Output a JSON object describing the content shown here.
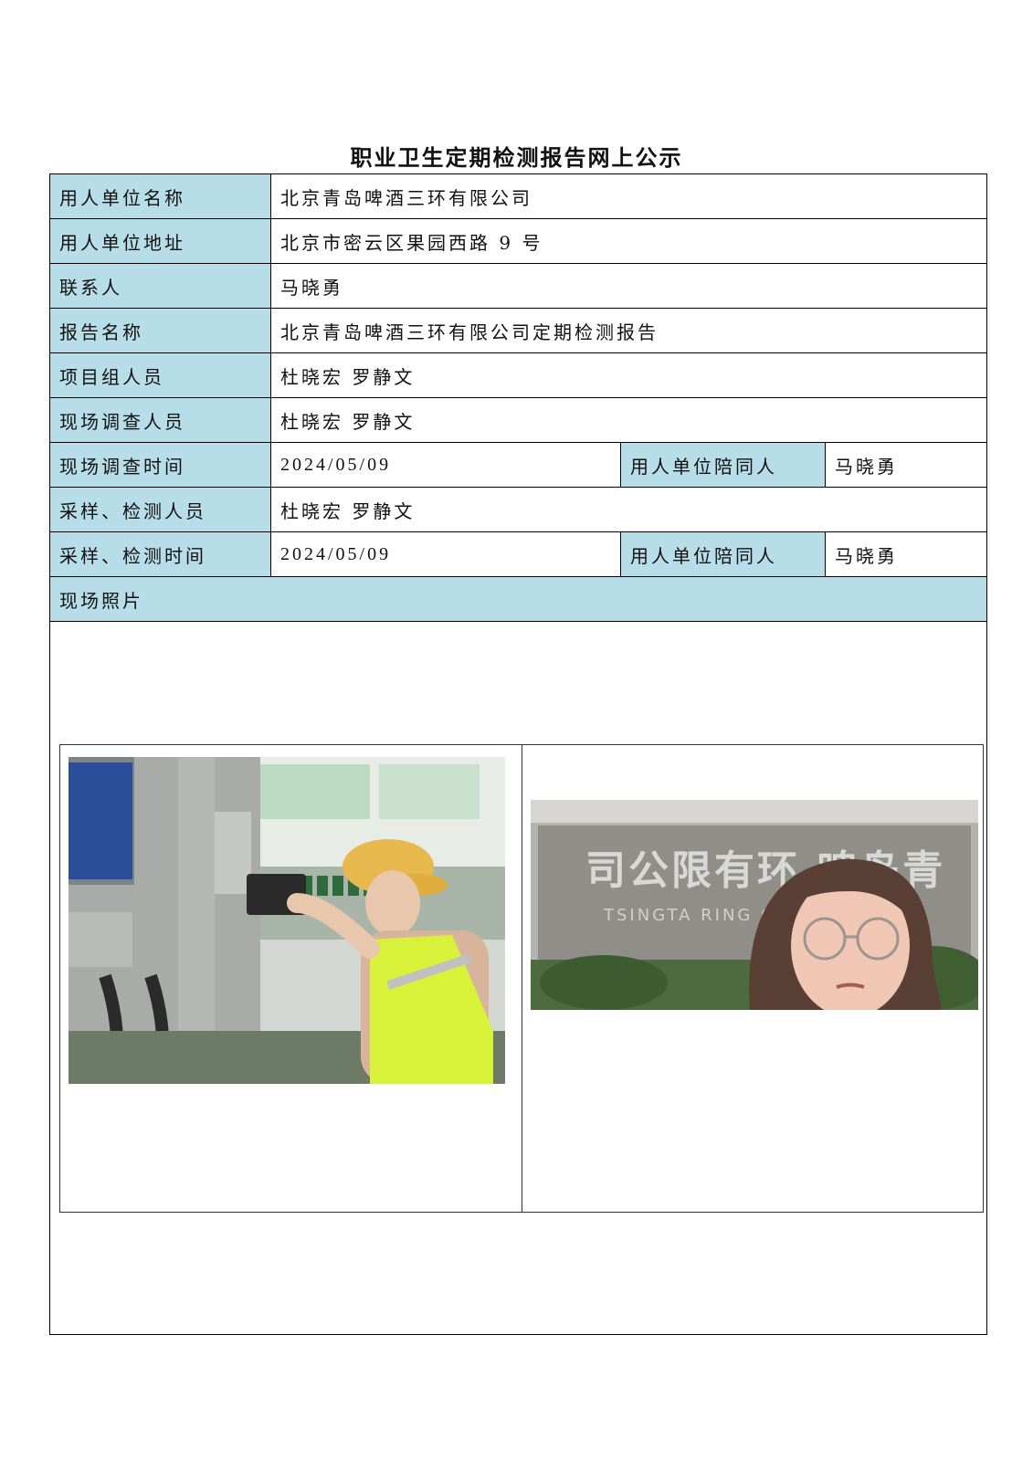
{
  "title": "职业卫生定期检测报告网上公示",
  "rows": {
    "unit_name": {
      "label": "用人单位名称",
      "value": "北京青岛啤酒三环有限公司"
    },
    "unit_address": {
      "label": "用人单位地址",
      "value": "北京市密云区果园西路 9 号"
    },
    "contact": {
      "label": "联系人",
      "value": "马晓勇"
    },
    "report_name": {
      "label": "报告名称",
      "value": "北京青岛啤酒三环有限公司定期检测报告"
    },
    "team": {
      "label": "项目组人员",
      "value": "杜晓宏 罗静文"
    },
    "survey_staff": {
      "label": "现场调查人员",
      "value": "杜晓宏 罗静文"
    },
    "survey_time": {
      "label": "现场调查时间",
      "value": "2024/05/09",
      "companion_label": "用人单位陪同人",
      "companion": "马晓勇"
    },
    "sampling_staff": {
      "label": "采样、检测人员",
      "value": "杜晓宏 罗静文"
    },
    "sampling_time": {
      "label": "采样、检测时间",
      "value": "2024/05/09",
      "companion_label": "用人单位陪同人",
      "companion": "马晓勇"
    },
    "photos": {
      "label": "现场照片"
    }
  },
  "photo2_sign": {
    "cn": "司公限有环  啤岛青",
    "en": "TSINGTA  RING CO.,LTD"
  },
  "colors": {
    "label_bg": "#b7dde8",
    "vest": "#d8f23a",
    "cap": "#e6b84e"
  }
}
